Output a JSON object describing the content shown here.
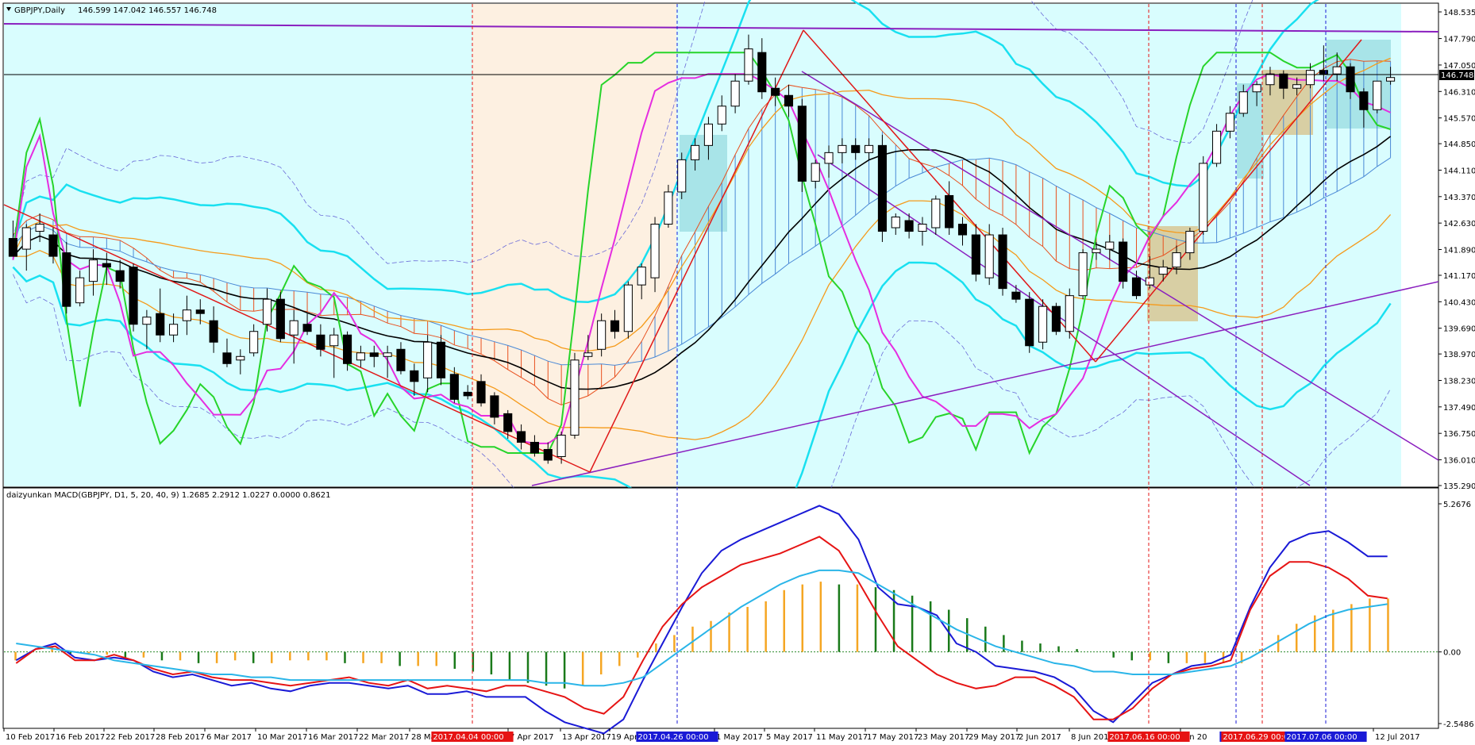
{
  "window": {
    "symbol_label": "GBPJPY,Daily",
    "ohlc_label": "146.599 147.042 146.557 146.748",
    "indicator_label": "daizyunkan MACD(GBPJPY, D1, 5, 20, 40, 9) 1.2685 2.2912 1.0227 0.0000 0.8621"
  },
  "colors": {
    "background": "#ffffff",
    "panel_bg": "#d9fdfe",
    "shade_orange": "#fdf0e1",
    "shade_cyan_box": "#a8e4e8",
    "shade_tan_box": "#d8cfa4",
    "bull_candle": "#ffffff",
    "bear_candle": "#000000",
    "kumo_red": "#e8501e",
    "kumo_blue": "#4a89d6",
    "macd_blue": "#1a1ad6",
    "macd_red": "#e61414",
    "macd_signal": "#2ab5e8",
    "hist_green": "#1a7a1a",
    "hist_orange": "#f5a623",
    "green_line": "#27d42a",
    "magenta_line": "#e52de0",
    "cyan_line": "#19e0f0",
    "orange_line": "#f59a1a",
    "purple_line": "#8a1fbf",
    "red_line": "#e01818"
  },
  "chart_data": [
    {
      "type": "candlestick",
      "title": "GBPJPY,Daily",
      "ylim": [
        135.29,
        148.535
      ],
      "price_ticks": [
        "148.535",
        "147.790",
        "147.050",
        "146.310",
        "145.570",
        "144.850",
        "144.110",
        "143.370",
        "142.630",
        "141.890",
        "141.170",
        "140.430",
        "139.690",
        "138.970",
        "138.230",
        "137.490",
        "136.750",
        "136.010",
        "135.290"
      ],
      "current_price": 146.748,
      "current_price_label": "146.748",
      "date_labels": [
        "10 Feb 2017",
        "16 Feb 2017",
        "22 Feb 2017",
        "28 Feb 2017",
        "6 Mar 2017",
        "10 Mar 2017",
        "16 Mar 2017",
        "22 Mar 2017",
        "28 Mar 20",
        "7 Apr 2017",
        "13 Apr 2017",
        "19 Apr 20",
        "1 May 2017",
        "5 May 2017",
        "11 May 2017",
        "17 May 2017",
        "23 May 2017",
        "29 May 2017",
        "2 Jun 2017",
        "8 Jun 2017",
        "Jun 20",
        "12 Jul 2017"
      ],
      "marked_dates": [
        {
          "label": "2017.04.04 00:00",
          "color": "#e61414"
        },
        {
          "label": "2017.04.26 00:00",
          "color": "#1a1ad6"
        },
        {
          "label": "2017.06.16 00:00",
          "color": "#e61414"
        },
        {
          "label": "2017.0",
          "color": "#1a1ad6"
        },
        {
          "label": "2017.06.29 00:00",
          "color": "#e61414"
        },
        {
          "label": "2017.07.06 00:00",
          "color": "#1a1ad6"
        }
      ],
      "candles": [
        {
          "o": 142.2,
          "h": 142.7,
          "l": 141.7,
          "c": 141.7
        },
        {
          "o": 141.9,
          "h": 142.6,
          "l": 141.3,
          "c": 142.5
        },
        {
          "o": 142.4,
          "h": 142.9,
          "l": 142.1,
          "c": 142.6
        },
        {
          "o": 142.3,
          "h": 142.5,
          "l": 141.5,
          "c": 141.7
        },
        {
          "o": 141.8,
          "h": 142.1,
          "l": 140.1,
          "c": 140.3
        },
        {
          "o": 140.4,
          "h": 141.3,
          "l": 140.3,
          "c": 141.1
        },
        {
          "o": 141.0,
          "h": 141.9,
          "l": 140.6,
          "c": 141.6
        },
        {
          "o": 141.5,
          "h": 141.8,
          "l": 140.9,
          "c": 141.4
        },
        {
          "o": 141.3,
          "h": 141.6,
          "l": 140.8,
          "c": 141.0
        },
        {
          "o": 141.4,
          "h": 141.5,
          "l": 139.6,
          "c": 139.8
        },
        {
          "o": 139.8,
          "h": 140.2,
          "l": 139.1,
          "c": 140.0
        },
        {
          "o": 140.1,
          "h": 140.8,
          "l": 139.3,
          "c": 139.5
        },
        {
          "o": 139.5,
          "h": 140.1,
          "l": 139.3,
          "c": 139.8
        },
        {
          "o": 139.9,
          "h": 140.6,
          "l": 139.5,
          "c": 140.2
        },
        {
          "o": 140.2,
          "h": 140.5,
          "l": 139.8,
          "c": 140.1
        },
        {
          "o": 139.9,
          "h": 140.3,
          "l": 139.0,
          "c": 139.3
        },
        {
          "o": 139.0,
          "h": 139.4,
          "l": 138.6,
          "c": 138.7
        },
        {
          "o": 138.8,
          "h": 139.1,
          "l": 138.4,
          "c": 138.9
        },
        {
          "o": 139.0,
          "h": 139.8,
          "l": 138.9,
          "c": 139.6
        },
        {
          "o": 139.8,
          "h": 140.8,
          "l": 139.6,
          "c": 140.5
        },
        {
          "o": 140.5,
          "h": 140.7,
          "l": 139.3,
          "c": 139.4
        },
        {
          "o": 139.5,
          "h": 140.2,
          "l": 138.7,
          "c": 139.9
        },
        {
          "o": 139.8,
          "h": 140.1,
          "l": 139.5,
          "c": 139.6
        },
        {
          "o": 139.5,
          "h": 139.8,
          "l": 138.9,
          "c": 139.1
        },
        {
          "o": 139.2,
          "h": 139.7,
          "l": 138.3,
          "c": 139.5
        },
        {
          "o": 139.5,
          "h": 139.6,
          "l": 138.5,
          "c": 138.7
        },
        {
          "o": 138.8,
          "h": 139.2,
          "l": 138.6,
          "c": 139.0
        },
        {
          "o": 139.0,
          "h": 139.2,
          "l": 138.6,
          "c": 138.9
        },
        {
          "o": 138.9,
          "h": 139.2,
          "l": 138.3,
          "c": 139.0
        },
        {
          "o": 139.1,
          "h": 139.3,
          "l": 138.4,
          "c": 138.5
        },
        {
          "o": 138.5,
          "h": 138.7,
          "l": 137.8,
          "c": 138.2
        },
        {
          "o": 138.3,
          "h": 139.5,
          "l": 137.9,
          "c": 139.3
        },
        {
          "o": 139.3,
          "h": 139.5,
          "l": 138.1,
          "c": 138.3
        },
        {
          "o": 138.4,
          "h": 138.6,
          "l": 137.6,
          "c": 137.7
        },
        {
          "o": 137.9,
          "h": 138.1,
          "l": 137.7,
          "c": 137.8
        },
        {
          "o": 138.2,
          "h": 138.4,
          "l": 137.5,
          "c": 137.6
        },
        {
          "o": 137.8,
          "h": 137.9,
          "l": 137.0,
          "c": 137.2
        },
        {
          "o": 137.3,
          "h": 137.4,
          "l": 136.6,
          "c": 136.8
        },
        {
          "o": 136.8,
          "h": 137.0,
          "l": 136.3,
          "c": 136.5
        },
        {
          "o": 136.5,
          "h": 136.7,
          "l": 136.1,
          "c": 136.2
        },
        {
          "o": 136.3,
          "h": 136.5,
          "l": 135.9,
          "c": 136.0
        },
        {
          "o": 136.1,
          "h": 136.8,
          "l": 135.9,
          "c": 136.7
        },
        {
          "o": 136.7,
          "h": 139.0,
          "l": 136.6,
          "c": 138.8
        },
        {
          "o": 138.9,
          "h": 139.5,
          "l": 138.8,
          "c": 139.0
        },
        {
          "o": 139.1,
          "h": 140.1,
          "l": 138.9,
          "c": 139.9
        },
        {
          "o": 139.9,
          "h": 140.2,
          "l": 139.4,
          "c": 139.6
        },
        {
          "o": 139.6,
          "h": 141.0,
          "l": 139.4,
          "c": 140.9
        },
        {
          "o": 140.9,
          "h": 141.5,
          "l": 140.5,
          "c": 141.4
        },
        {
          "o": 141.1,
          "h": 142.8,
          "l": 140.7,
          "c": 142.6
        },
        {
          "o": 142.6,
          "h": 143.7,
          "l": 142.5,
          "c": 143.5
        },
        {
          "o": 143.5,
          "h": 144.6,
          "l": 143.3,
          "c": 144.4
        },
        {
          "o": 144.4,
          "h": 145.0,
          "l": 144.1,
          "c": 144.8
        },
        {
          "o": 144.8,
          "h": 145.6,
          "l": 144.4,
          "c": 145.4
        },
        {
          "o": 145.4,
          "h": 146.2,
          "l": 145.2,
          "c": 145.9
        },
        {
          "o": 145.9,
          "h": 146.8,
          "l": 145.7,
          "c": 146.6
        },
        {
          "o": 146.6,
          "h": 147.9,
          "l": 146.5,
          "c": 147.5
        },
        {
          "o": 147.4,
          "h": 147.8,
          "l": 146.1,
          "c": 146.3
        },
        {
          "o": 146.4,
          "h": 146.7,
          "l": 145.9,
          "c": 146.2
        },
        {
          "o": 146.2,
          "h": 146.5,
          "l": 145.6,
          "c": 145.9
        },
        {
          "o": 145.9,
          "h": 146.1,
          "l": 143.5,
          "c": 143.8
        },
        {
          "o": 143.8,
          "h": 144.4,
          "l": 143.6,
          "c": 144.3
        },
        {
          "o": 144.3,
          "h": 144.8,
          "l": 143.9,
          "c": 144.6
        },
        {
          "o": 144.6,
          "h": 145.0,
          "l": 144.3,
          "c": 144.8
        },
        {
          "o": 144.8,
          "h": 145.0,
          "l": 144.4,
          "c": 144.6
        },
        {
          "o": 144.6,
          "h": 145.0,
          "l": 144.4,
          "c": 144.8
        },
        {
          "o": 144.8,
          "h": 145.1,
          "l": 142.1,
          "c": 142.4
        },
        {
          "o": 142.5,
          "h": 142.9,
          "l": 142.3,
          "c": 142.8
        },
        {
          "o": 142.7,
          "h": 142.9,
          "l": 142.2,
          "c": 142.4
        },
        {
          "o": 142.4,
          "h": 142.8,
          "l": 142.0,
          "c": 142.6
        },
        {
          "o": 142.5,
          "h": 143.4,
          "l": 142.3,
          "c": 143.3
        },
        {
          "o": 143.4,
          "h": 143.8,
          "l": 142.3,
          "c": 142.5
        },
        {
          "o": 142.6,
          "h": 142.8,
          "l": 142.0,
          "c": 142.3
        },
        {
          "o": 142.3,
          "h": 142.6,
          "l": 141.0,
          "c": 141.2
        },
        {
          "o": 141.1,
          "h": 142.6,
          "l": 140.9,
          "c": 142.3
        },
        {
          "o": 142.3,
          "h": 142.5,
          "l": 140.6,
          "c": 140.8
        },
        {
          "o": 140.7,
          "h": 140.9,
          "l": 140.4,
          "c": 140.5
        },
        {
          "o": 140.5,
          "h": 140.7,
          "l": 139.0,
          "c": 139.2
        },
        {
          "o": 139.3,
          "h": 140.5,
          "l": 139.1,
          "c": 140.3
        },
        {
          "o": 140.3,
          "h": 140.4,
          "l": 139.5,
          "c": 139.6
        },
        {
          "o": 139.6,
          "h": 140.8,
          "l": 139.4,
          "c": 140.6
        },
        {
          "o": 140.6,
          "h": 141.9,
          "l": 140.5,
          "c": 141.8
        },
        {
          "o": 141.8,
          "h": 142.1,
          "l": 141.6,
          "c": 141.9
        },
        {
          "o": 141.9,
          "h": 142.3,
          "l": 141.6,
          "c": 142.1
        },
        {
          "o": 142.1,
          "h": 142.2,
          "l": 140.8,
          "c": 141.0
        },
        {
          "o": 141.1,
          "h": 141.3,
          "l": 140.5,
          "c": 140.6
        },
        {
          "o": 140.9,
          "h": 141.7,
          "l": 140.8,
          "c": 141.1
        },
        {
          "o": 141.2,
          "h": 141.6,
          "l": 141.0,
          "c": 141.4
        },
        {
          "o": 141.4,
          "h": 142.0,
          "l": 141.2,
          "c": 141.8
        },
        {
          "o": 141.8,
          "h": 142.5,
          "l": 141.6,
          "c": 142.4
        },
        {
          "o": 142.4,
          "h": 144.5,
          "l": 142.3,
          "c": 144.3
        },
        {
          "o": 144.3,
          "h": 145.4,
          "l": 144.2,
          "c": 145.2
        },
        {
          "o": 145.2,
          "h": 145.9,
          "l": 145.0,
          "c": 145.7
        },
        {
          "o": 145.7,
          "h": 146.5,
          "l": 145.6,
          "c": 146.3
        },
        {
          "o": 146.3,
          "h": 146.6,
          "l": 145.9,
          "c": 146.5
        },
        {
          "o": 146.5,
          "h": 147.0,
          "l": 146.2,
          "c": 146.8
        },
        {
          "o": 146.8,
          "h": 146.9,
          "l": 146.1,
          "c": 146.4
        },
        {
          "o": 146.4,
          "h": 146.7,
          "l": 146.2,
          "c": 146.5
        },
        {
          "o": 146.5,
          "h": 147.1,
          "l": 146.4,
          "c": 146.9
        },
        {
          "o": 146.9,
          "h": 147.6,
          "l": 146.6,
          "c": 146.8
        },
        {
          "o": 146.8,
          "h": 147.4,
          "l": 146.6,
          "c": 147.0
        },
        {
          "o": 147.0,
          "h": 147.1,
          "l": 146.1,
          "c": 146.3
        },
        {
          "o": 146.3,
          "h": 146.4,
          "l": 145.3,
          "c": 145.8
        },
        {
          "o": 145.8,
          "h": 146.6,
          "l": 145.7,
          "c": 146.6
        },
        {
          "o": 146.6,
          "h": 147.0,
          "l": 146.5,
          "c": 146.7
        }
      ]
    },
    {
      "type": "line",
      "title": "daizyunkan MACD(GBPJPY, D1, 5, 20, 40, 9)",
      "ylim": [
        -2.5486,
        5.2676
      ],
      "value_ticks": [
        "5.2676",
        "0.00",
        "-2.5486"
      ],
      "series": [
        {
          "values": [
            -0.3,
            0.1,
            0.3,
            -0.2,
            -0.3,
            -0.2,
            -0.3,
            -0.7,
            -0.9,
            -0.8,
            -1.0,
            -1.2,
            -1.1,
            -1.3,
            -1.4,
            -1.2,
            -1.1,
            -1.1,
            -1.2,
            -1.3,
            -1.2,
            -1.5,
            -1.5,
            -1.4,
            -1.6,
            -1.6,
            -1.6,
            -2.1,
            -2.5,
            -2.7,
            -2.9,
            -2.4,
            -1.0,
            0.3,
            1.6,
            2.8,
            3.6,
            4.0,
            4.3,
            4.6,
            4.9,
            5.2,
            4.9,
            4.0,
            2.3,
            1.7,
            1.6,
            1.3,
            0.3,
            0.0,
            -0.5,
            -0.6,
            -0.7,
            -0.9,
            -1.3,
            -2.1,
            -2.5,
            -1.8,
            -1.1,
            -0.8,
            -0.5,
            -0.4,
            -0.1,
            1.6,
            3.0,
            3.9,
            4.2,
            4.3,
            3.9,
            3.4,
            3.4
          ],
          "name": ""
        },
        {
          "values": [
            -0.4,
            0.1,
            0.2,
            -0.3,
            -0.3,
            -0.1,
            -0.3,
            -0.6,
            -0.8,
            -0.7,
            -0.9,
            -1.0,
            -1.0,
            -1.1,
            -1.2,
            -1.1,
            -1.0,
            -0.9,
            -1.1,
            -1.2,
            -1.0,
            -1.3,
            -1.2,
            -1.3,
            -1.4,
            -1.2,
            -1.2,
            -1.4,
            -1.6,
            -2.0,
            -2.2,
            -1.6,
            -0.3,
            0.9,
            1.7,
            2.3,
            2.7,
            3.1,
            3.3,
            3.5,
            3.8,
            4.1,
            3.6,
            2.5,
            1.3,
            0.2,
            -0.3,
            -0.8,
            -1.1,
            -1.3,
            -1.2,
            -0.9,
            -0.9,
            -1.2,
            -1.6,
            -2.4,
            -2.4,
            -2.0,
            -1.3,
            -0.8,
            -0.6,
            -0.5,
            -0.3,
            1.5,
            2.7,
            3.2,
            3.2,
            3.0,
            2.6,
            2.0,
            1.9
          ],
          "name": ""
        },
        {
          "values": [
            0.3,
            0.2,
            0.1,
            0.0,
            -0.1,
            -0.3,
            -0.4,
            -0.5,
            -0.6,
            -0.7,
            -0.8,
            -0.8,
            -0.9,
            -0.9,
            -1.0,
            -1.0,
            -1.0,
            -1.0,
            -1.0,
            -1.0,
            -1.0,
            -1.0,
            -1.0,
            -1.0,
            -1.0,
            -1.0,
            -1.0,
            -1.1,
            -1.1,
            -1.2,
            -1.2,
            -1.1,
            -0.9,
            -0.4,
            0.1,
            0.6,
            1.1,
            1.6,
            2.0,
            2.4,
            2.7,
            2.9,
            2.9,
            2.8,
            2.4,
            2.0,
            1.6,
            1.2,
            0.8,
            0.5,
            0.2,
            0.0,
            -0.2,
            -0.4,
            -0.5,
            -0.7,
            -0.7,
            -0.8,
            -0.8,
            -0.8,
            -0.7,
            -0.6,
            -0.5,
            -0.2,
            0.2,
            0.6,
            1.0,
            1.3,
            1.5,
            1.6,
            1.7
          ],
          "name": ""
        }
      ],
      "histogram": [
        -0.3,
        0.0,
        0.2,
        -0.1,
        -0.1,
        -0.1,
        -0.2,
        -0.2,
        -0.3,
        -0.3,
        -0.4,
        -0.4,
        -0.3,
        -0.4,
        -0.4,
        -0.3,
        -0.3,
        -0.3,
        -0.4,
        -0.4,
        -0.4,
        -0.5,
        -0.5,
        -0.5,
        -0.6,
        -0.7,
        -0.8,
        -1.0,
        -1.1,
        -1.2,
        -1.3,
        -1.2,
        -0.8,
        -0.5,
        -0.2,
        0.3,
        0.6,
        0.9,
        1.1,
        1.4,
        1.6,
        1.8,
        2.2,
        2.4,
        2.5,
        2.4,
        2.4,
        2.3,
        2.2,
        2.0,
        1.8,
        1.5,
        1.2,
        0.9,
        0.6,
        0.4,
        0.3,
        0.2,
        0.1,
        0.0,
        -0.2,
        -0.3,
        -0.3,
        -0.4,
        -0.4,
        -0.4,
        -0.4,
        -0.4,
        0.1,
        0.6,
        1.0,
        1.3,
        1.5,
        1.7,
        1.9,
        1.9
      ]
    }
  ]
}
